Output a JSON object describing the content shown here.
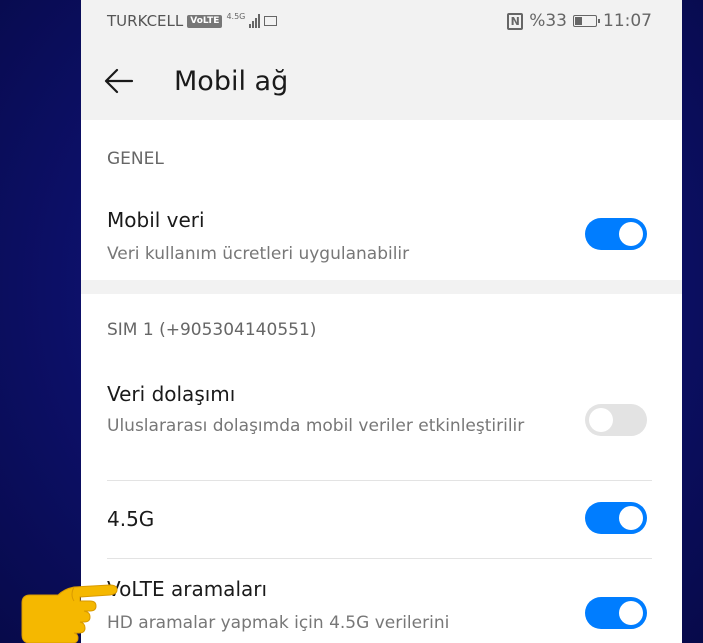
{
  "status_bar": {
    "carrier": "TURKCELL",
    "volte_badge": "VoLTE",
    "network": "4.5G",
    "battery": "%33",
    "time": "11:07"
  },
  "app_bar": {
    "title": "Mobil ağ",
    "back_icon": "arrow-left-icon"
  },
  "general": {
    "header": "GENEL",
    "mobile_data": {
      "title": "Mobil veri",
      "subtitle": "Veri kullanım ücretleri uygulanabilir",
      "enabled": true
    }
  },
  "sim1": {
    "header": "SIM 1 (+905304140551)",
    "roaming": {
      "title": "Veri dolaşımı",
      "subtitle": "Uluslararası dolaşımda mobil veriler etkinleştirilir",
      "enabled": false
    },
    "lte": {
      "title": "4.5G",
      "enabled": true
    },
    "volte": {
      "title": "VoLTE aramaları",
      "subtitle": "HD aramalar yapmak için 4.5G verilerini",
      "enabled": true
    }
  },
  "colors": {
    "accent": "#007dff",
    "background": "#0e1170",
    "pointer": "#f5b800"
  },
  "annotation": {
    "pointer_icon": "pointing-hand-icon"
  }
}
